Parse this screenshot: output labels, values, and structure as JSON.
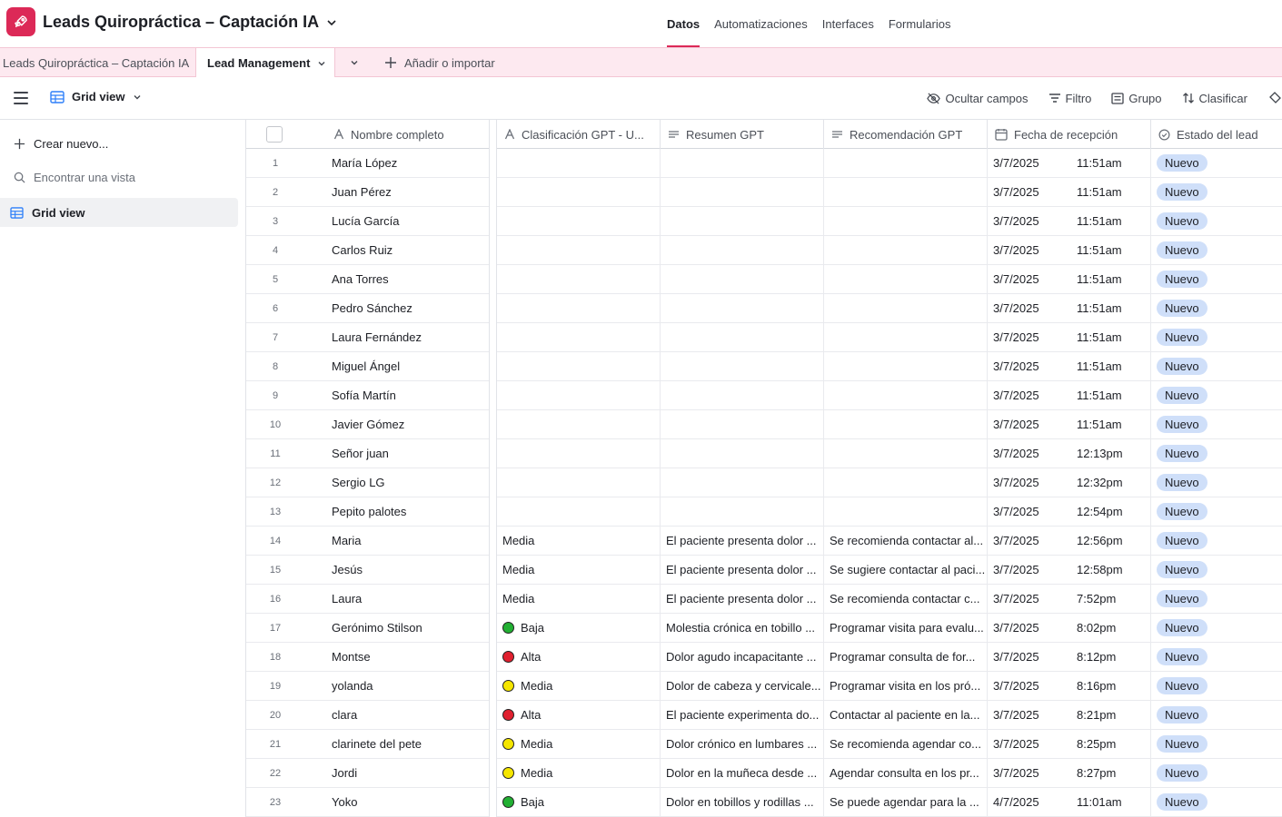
{
  "app": {
    "base_title": "Leads Quiropráctica – Captación IA",
    "brand_color": "#dc2957"
  },
  "top_nav": [
    {
      "label": "Datos",
      "active": true
    },
    {
      "label": "Automatizaciones",
      "active": false
    },
    {
      "label": "Interfaces",
      "active": false
    },
    {
      "label": "Formularios",
      "active": false
    }
  ],
  "tabs": {
    "inactive": "Leads Quiropráctica – Captación IA",
    "active": "Lead Management",
    "add": "Añadir o importar"
  },
  "view_bar": {
    "view_name": "Grid view",
    "tools": [
      {
        "label": "Ocultar campos",
        "icon": "eye-off-icon"
      },
      {
        "label": "Filtro",
        "icon": "filter-icon"
      },
      {
        "label": "Grupo",
        "icon": "group-icon"
      },
      {
        "label": "Clasificar",
        "icon": "sort-icon"
      }
    ]
  },
  "sidebar": {
    "create": "Crear nuevo...",
    "search": "Encontrar una vista",
    "views": [
      "Grid view"
    ]
  },
  "columns": [
    {
      "label": "Nombre completo",
      "icon": "text-field-icon"
    },
    {
      "label": "Clasificación GPT - U...",
      "icon": "text-field-icon"
    },
    {
      "label": "Resumen GPT",
      "icon": "long-text-icon"
    },
    {
      "label": "Recomendación GPT",
      "icon": "long-text-icon"
    },
    {
      "label": "Fecha de recepción",
      "icon": "calendar-icon"
    },
    {
      "label": "Estado del lead",
      "icon": "status-icon"
    }
  ],
  "priority_colors": {
    "Baja": "#22b033",
    "Alta": "#e0202f",
    "Media": "#f5e600"
  },
  "rows": [
    {
      "n": "1",
      "name": "María López",
      "clas": "",
      "dot": "",
      "resumen": "",
      "recom": "",
      "date": "3/7/2025",
      "time": "11:51am",
      "estado": "Nuevo"
    },
    {
      "n": "2",
      "name": "Juan Pérez",
      "clas": "",
      "dot": "",
      "resumen": "",
      "recom": "",
      "date": "3/7/2025",
      "time": "11:51am",
      "estado": "Nuevo"
    },
    {
      "n": "3",
      "name": "Lucía García",
      "clas": "",
      "dot": "",
      "resumen": "",
      "recom": "",
      "date": "3/7/2025",
      "time": "11:51am",
      "estado": "Nuevo"
    },
    {
      "n": "4",
      "name": "Carlos Ruiz",
      "clas": "",
      "dot": "",
      "resumen": "",
      "recom": "",
      "date": "3/7/2025",
      "time": "11:51am",
      "estado": "Nuevo"
    },
    {
      "n": "5",
      "name": "Ana Torres",
      "clas": "",
      "dot": "",
      "resumen": "",
      "recom": "",
      "date": "3/7/2025",
      "time": "11:51am",
      "estado": "Nuevo"
    },
    {
      "n": "6",
      "name": "Pedro Sánchez",
      "clas": "",
      "dot": "",
      "resumen": "",
      "recom": "",
      "date": "3/7/2025",
      "time": "11:51am",
      "estado": "Nuevo"
    },
    {
      "n": "7",
      "name": "Laura Fernández",
      "clas": "",
      "dot": "",
      "resumen": "",
      "recom": "",
      "date": "3/7/2025",
      "time": "11:51am",
      "estado": "Nuevo"
    },
    {
      "n": "8",
      "name": "Miguel Ángel",
      "clas": "",
      "dot": "",
      "resumen": "",
      "recom": "",
      "date": "3/7/2025",
      "time": "11:51am",
      "estado": "Nuevo"
    },
    {
      "n": "9",
      "name": "Sofía Martín",
      "clas": "",
      "dot": "",
      "resumen": "",
      "recom": "",
      "date": "3/7/2025",
      "time": "11:51am",
      "estado": "Nuevo"
    },
    {
      "n": "10",
      "name": "Javier Gómez",
      "clas": "",
      "dot": "",
      "resumen": "",
      "recom": "",
      "date": "3/7/2025",
      "time": "11:51am",
      "estado": "Nuevo"
    },
    {
      "n": "11",
      "name": "Señor juan",
      "clas": "",
      "dot": "",
      "resumen": "",
      "recom": "",
      "date": "3/7/2025",
      "time": "12:13pm",
      "estado": "Nuevo"
    },
    {
      "n": "12",
      "name": "Sergio LG",
      "clas": "",
      "dot": "",
      "resumen": "",
      "recom": "",
      "date": "3/7/2025",
      "time": "12:32pm",
      "estado": "Nuevo"
    },
    {
      "n": "13",
      "name": "Pepito palotes",
      "clas": "",
      "dot": "",
      "resumen": "",
      "recom": "",
      "date": "3/7/2025",
      "time": "12:54pm",
      "estado": "Nuevo"
    },
    {
      "n": "14",
      "name": "Maria",
      "clas": "Media",
      "dot": "",
      "resumen": "El paciente presenta dolor ...",
      "recom": "Se recomienda contactar al...",
      "date": "3/7/2025",
      "time": "12:56pm",
      "estado": "Nuevo"
    },
    {
      "n": "15",
      "name": "Jesús",
      "clas": "Media",
      "dot": "",
      "resumen": "El paciente presenta dolor ...",
      "recom": "Se sugiere contactar al paci...",
      "date": "3/7/2025",
      "time": "12:58pm",
      "estado": "Nuevo"
    },
    {
      "n": "16",
      "name": "Laura",
      "clas": "Media",
      "dot": "",
      "resumen": "El paciente presenta dolor ...",
      "recom": "Se recomienda contactar c...",
      "date": "3/7/2025",
      "time": "7:52pm",
      "estado": "Nuevo"
    },
    {
      "n": "17",
      "name": "Gerónimo Stilson",
      "clas": "Baja",
      "dot": "#22b033",
      "resumen": "Molestia crónica en tobillo ...",
      "recom": "Programar visita para evalu...",
      "date": "3/7/2025",
      "time": "8:02pm",
      "estado": "Nuevo"
    },
    {
      "n": "18",
      "name": "Montse",
      "clas": "Alta",
      "dot": "#e0202f",
      "resumen": "Dolor agudo incapacitante ...",
      "recom": "Programar consulta de for...",
      "date": "3/7/2025",
      "time": "8:12pm",
      "estado": "Nuevo"
    },
    {
      "n": "19",
      "name": "yolanda",
      "clas": "Media",
      "dot": "#f5e600",
      "resumen": "Dolor de cabeza y cervicale...",
      "recom": "Programar visita en los pró...",
      "date": "3/7/2025",
      "time": "8:16pm",
      "estado": "Nuevo"
    },
    {
      "n": "20",
      "name": "clara",
      "clas": "Alta",
      "dot": "#e0202f",
      "resumen": "El paciente experimenta do...",
      "recom": "Contactar al paciente en la...",
      "date": "3/7/2025",
      "time": "8:21pm",
      "estado": "Nuevo"
    },
    {
      "n": "21",
      "name": "clarinete del pete",
      "clas": "Media",
      "dot": "#f5e600",
      "resumen": "Dolor crónico en lumbares ...",
      "recom": "Se recomienda agendar co...",
      "date": "3/7/2025",
      "time": "8:25pm",
      "estado": "Nuevo"
    },
    {
      "n": "22",
      "name": "Jordi",
      "clas": "Media",
      "dot": "#f5e600",
      "resumen": "Dolor en la muñeca desde ...",
      "recom": "Agendar consulta en los pr...",
      "date": "3/7/2025",
      "time": "8:27pm",
      "estado": "Nuevo"
    },
    {
      "n": "23",
      "name": "Yoko",
      "clas": "Baja",
      "dot": "#22b033",
      "resumen": "Dolor en tobillos y rodillas ...",
      "recom": "Se puede agendar para la ...",
      "date": "4/7/2025",
      "time": "11:01am",
      "estado": "Nuevo"
    }
  ]
}
